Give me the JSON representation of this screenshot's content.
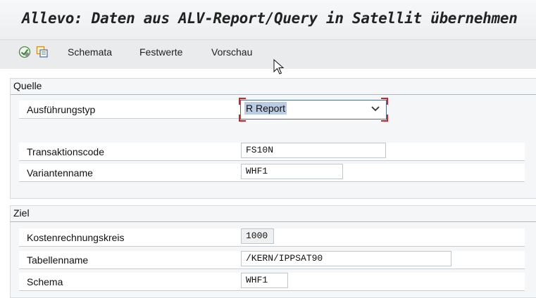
{
  "window": {
    "title": "Allevo: Daten aus ALV-Report/Query in Satellit übernehmen"
  },
  "toolbar": {
    "icons": [
      "execute-icon",
      "copy-icon"
    ],
    "schemata_label": "Schemata",
    "festwerte_label": "Festwerte",
    "vorschau_label": "Vorschau"
  },
  "quelle": {
    "title": "Quelle",
    "ausfuehrungstyp_label": "Ausführungstyp",
    "ausfuehrungstyp_value": "R Report",
    "transaktionscode_label": "Transaktionscode",
    "transaktionscode_value": "FS10N",
    "variantenname_label": "Variantenname",
    "variantenname_value": "WHF1"
  },
  "ziel": {
    "title": "Ziel",
    "kostenrechnungskreis_label": "Kostenrechnungskreis",
    "kostenrechnungskreis_value": "1000",
    "tabellenname_label": "Tabellenname",
    "tabellenname_value": "/KERN/IPPSAT90",
    "schema_label": "Schema",
    "schema_value": "WHF1"
  },
  "colors": {
    "selection_highlight": "#b9cce3",
    "focus_marker": "#d32020",
    "group_border": "#aeb6bd"
  }
}
